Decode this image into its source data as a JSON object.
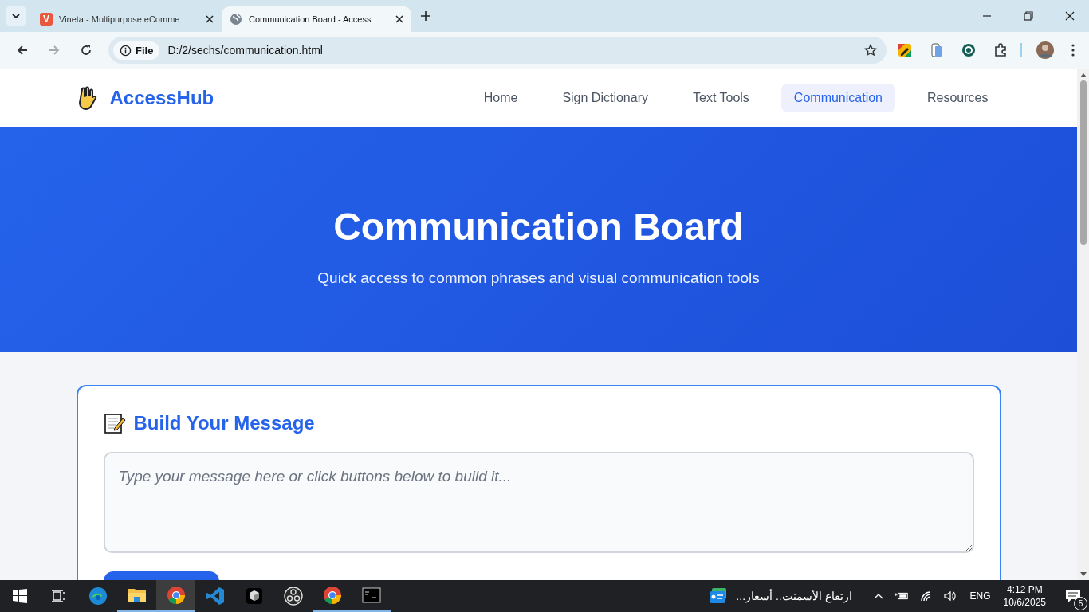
{
  "browser": {
    "tabs": [
      {
        "title": "Vineta - Multipurpose eComme",
        "selected": false,
        "kind": "letter",
        "icon_text": "V"
      },
      {
        "title": "Communication Board - Access",
        "selected": true,
        "kind": "globe"
      }
    ],
    "address": {
      "scheme": "File",
      "url": "D:/2/sechs/communication.html"
    }
  },
  "site": {
    "brand": "AccessHub",
    "nav": [
      {
        "label": "Home",
        "selected": false
      },
      {
        "label": "Sign Dictionary",
        "selected": false
      },
      {
        "label": "Text Tools",
        "selected": false
      },
      {
        "label": "Communication",
        "selected": true
      },
      {
        "label": "Resources",
        "selected": false
      }
    ]
  },
  "hero": {
    "title": "Communication Board",
    "subtitle": "Quick access to common phrases and visual communication tools"
  },
  "message": {
    "title": "Build Your Message",
    "placeholder": "Type your message here or click buttons below to build it..."
  },
  "taskbar": {
    "apps": [
      {
        "kind": "edge",
        "running": false,
        "active": false
      },
      {
        "kind": "folder",
        "running": true,
        "active": false
      },
      {
        "kind": "chrome",
        "running": true,
        "active": true
      },
      {
        "kind": "vscode",
        "running": false,
        "active": false
      },
      {
        "kind": "cube",
        "running": false,
        "active": false
      },
      {
        "kind": "obs",
        "running": false,
        "active": false
      },
      {
        "kind": "chrome",
        "running": true,
        "active": false
      },
      {
        "kind": "terminal",
        "running": true,
        "active": false
      }
    ],
    "news": "ارتفاع الأسمنت.. أسعار...",
    "language": "ENG",
    "time": "4:12 PM",
    "date": "10/6/2025",
    "notifications": "5"
  }
}
